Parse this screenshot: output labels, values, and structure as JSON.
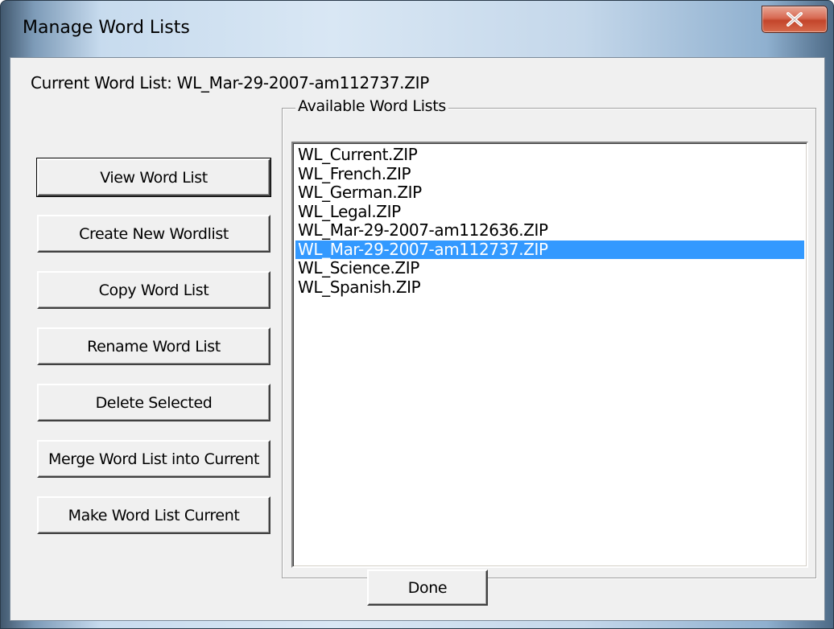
{
  "window": {
    "title": "Manage Word Lists",
    "close_glyph": "X"
  },
  "current": {
    "label": "Current Word List:  WL_Mar-29-2007-am112737.ZIP"
  },
  "buttons": {
    "view": "View Word List",
    "create": "Create New Wordlist",
    "copy": "Copy Word List",
    "rename": "Rename Word List",
    "delete": "Delete Selected",
    "merge": "Merge Word List into Current",
    "make_current": "Make Word List Current",
    "done": "Done"
  },
  "available": {
    "legend": "Available Word Lists",
    "items": [
      "WL_Current.ZIP",
      "WL_French.ZIP",
      "WL_German.ZIP",
      "WL_Legal.ZIP",
      "WL_Mar-29-2007-am112636.ZIP",
      "WL_Mar-29-2007-am112737.ZIP",
      "WL_Science.ZIP",
      "WL_Spanish.ZIP"
    ],
    "selected_index": 5
  },
  "colors": {
    "selection": "#3399ff",
    "close_button": "#c3452b",
    "dialog_face": "#f0f0f0"
  }
}
